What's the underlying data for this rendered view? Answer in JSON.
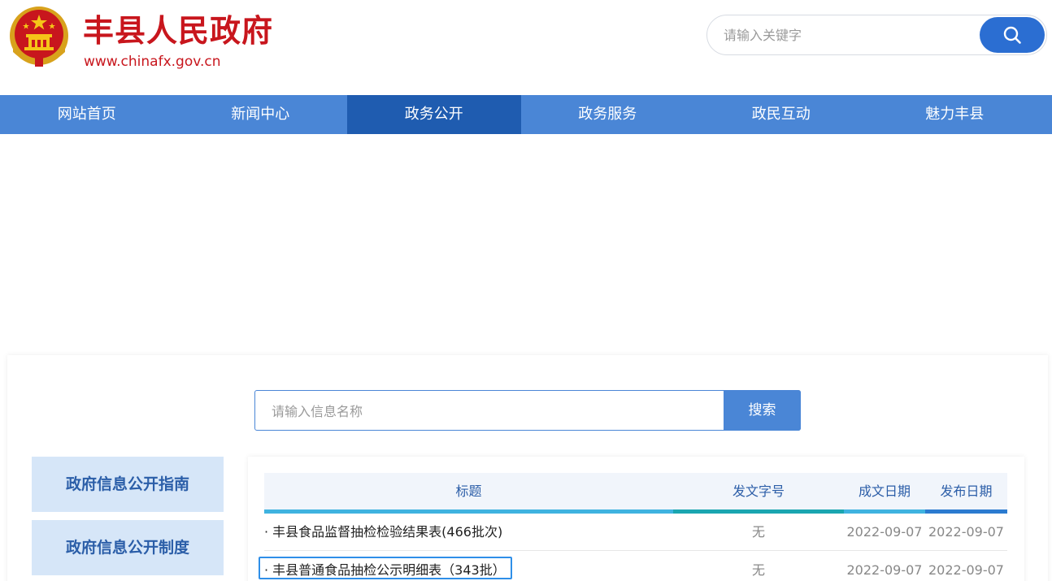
{
  "header": {
    "title": "丰县人民政府",
    "url": "www.chinafx.gov.cn",
    "search": {
      "placeholder": "请输入关键字"
    }
  },
  "nav": {
    "items": [
      {
        "label": "网站首页"
      },
      {
        "label": "新闻中心"
      },
      {
        "label": "政务公开"
      },
      {
        "label": "政务服务"
      },
      {
        "label": "政民互动"
      },
      {
        "label": "魅力丰县"
      }
    ],
    "active_index": 2
  },
  "info_search": {
    "placeholder": "请输入信息名称",
    "button_label": "搜索"
  },
  "sidebar": {
    "items": [
      {
        "label": "政府信息公开指南"
      },
      {
        "label": "政府信息公开制度"
      }
    ]
  },
  "table": {
    "headers": {
      "title": "标题",
      "doc_no": "发文字号",
      "created": "成文日期",
      "published": "发布日期"
    },
    "rows": [
      {
        "title": "· 丰县食品监督抽检检验结果表(466批次)",
        "doc_no": "无",
        "created": "2022-09-07",
        "published": "2022-09-07"
      },
      {
        "title": "· 丰县普通食品抽检公示明细表（343批）",
        "doc_no": "无",
        "created": "2022-09-07",
        "published": "2022-09-07"
      }
    ]
  },
  "colors": {
    "brand_red": "#c8161d",
    "nav_blue": "#4a86d6",
    "nav_active": "#1f5cb0",
    "header_line_cyan": "#3fb3e0",
    "header_line_teal": "#1aa6b0",
    "header_line_blue": "#2b7bd0"
  }
}
